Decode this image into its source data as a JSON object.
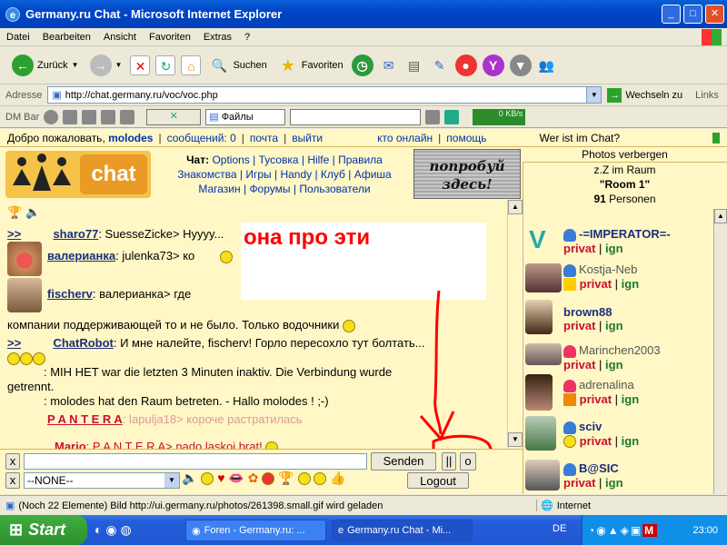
{
  "window": {
    "title": "Germany.ru Chat - Microsoft Internet Explorer"
  },
  "menu": [
    "Datei",
    "Bearbeiten",
    "Ansicht",
    "Favoriten",
    "Extras",
    "?"
  ],
  "toolbar": {
    "back": "Zurück",
    "search": "Suchen",
    "favorites": "Favoriten"
  },
  "address": {
    "label": "Adresse",
    "url": "http://chat.germany.ru/voc/voc.php",
    "go": "Wechseln zu",
    "links": "Links"
  },
  "dmbar": {
    "label": "DM Bar",
    "files": "Файлы",
    "speed": "0 KB/s"
  },
  "welcome": {
    "greeting": "Добро пожаловать,",
    "user": "molodes",
    "messages": "сообщений: 0",
    "mail": "почта",
    "logout": "выйти",
    "who_online": "кто онлайн",
    "help": "помощь",
    "who_chat": "Wer ist im Chat?"
  },
  "nav": {
    "row1": [
      "Чат:",
      "Options",
      "Тусовка",
      "Hilfe",
      "Правила"
    ],
    "row2": [
      "Знакомства",
      "Игры",
      "Handy",
      "Клуб",
      "Афиша"
    ],
    "row3": [
      "Магазин",
      "Форумы",
      "Пользователи"
    ],
    "logo_text": "chat",
    "promo": "попробуй здесь!"
  },
  "chat": {
    "lines": [
      {
        "prefix": ">>",
        "nick": "sharo77",
        "text": ": SuesseZicke> Hyyyy..."
      },
      {
        "prefix": "",
        "nick": "валерианка",
        "text": ": julenka73> ко"
      },
      {
        "prefix": "",
        "nick": "fischerv",
        "text": ": валерианка> где"
      },
      {
        "prefix": "",
        "nick": "",
        "text": "компании поддерживающей то и не было. Только водочники"
      },
      {
        "prefix": ">>",
        "nick": "ChatRobot",
        "text": ": И мне налейте, fischerv! Горло пересохло тут болтать..."
      },
      {
        "prefix": "",
        "nick": "",
        "text": ": MIH HET war die letzten 3 Minuten inaktiv. Die Verbindung wurde"
      },
      {
        "prefix": "",
        "nick": "",
        "text": "getrennt."
      },
      {
        "prefix": "",
        "nick": "",
        "text": ": molodes hat den Raum betreten. - Hallo molodes ! ;-)"
      },
      {
        "prefix": "",
        "nick": "P A N T E R A",
        "text": ": lapulja18> короче растратилась"
      },
      {
        "prefix": "",
        "nick": "Mario",
        "text": ": P A N T E R A> nado laskoi brat!"
      }
    ]
  },
  "annotation": "она про эти",
  "input": {
    "send": "Senden",
    "pause": "||",
    "o": "o",
    "x": "x",
    "select": "--NONE--",
    "logout": "Logout"
  },
  "room": {
    "photos": "Photos verbergen",
    "now": "z.Z im Raum",
    "name": "\"Room 1\"",
    "count": "91",
    "persons": "Personen"
  },
  "users": [
    {
      "name": "-=IMPERATOR=-",
      "privat": "privat",
      "ign": "ign"
    },
    {
      "name": "Kostja-Neb",
      "privat": "privat",
      "ign": "ign"
    },
    {
      "name": "brown88",
      "privat": "privat",
      "ign": "ign"
    },
    {
      "name": "Marinchen2003",
      "privat": "privat",
      "ign": "ign"
    },
    {
      "name": "adrenalina",
      "privat": "privat",
      "ign": "ign"
    },
    {
      "name": "sciv",
      "privat": "privat",
      "ign": "ign"
    },
    {
      "name": "B@SIC",
      "privat": "privat",
      "ign": "ign"
    }
  ],
  "status": {
    "text": "(Noch 22 Elemente) Bild http://ui.germany.ru/photos/261398.small.gif wird geladen",
    "zone": "Internet"
  },
  "taskbar": {
    "start": "Start",
    "task1": "Foren - Germany.ru: ...",
    "task2": "Germany.ru Chat - Mi...",
    "lang": "DE",
    "time": "23:00"
  }
}
